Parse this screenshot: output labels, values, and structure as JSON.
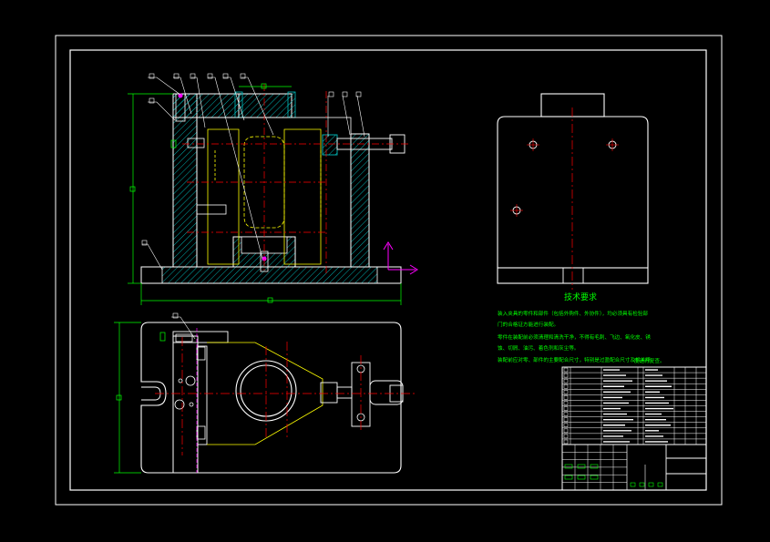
{
  "drawing": {
    "background": "#000000",
    "colors": {
      "outline": "#ffffff",
      "hatch": "#00c0c0",
      "centerline": "#ff0000",
      "hidden": "#ffff00",
      "dimension": "#00ff00",
      "ucs": "#ff00ff",
      "leader": "#ffffff",
      "title_block_text": "#00ff00"
    },
    "tech_requirements": {
      "title": "技术要求",
      "lines": [
        "装入夹具的零件和部件（包括外购件、外协件），均必须具有检验部",
        "门的合格证方能进行装配。",
        "零件在装配前必须清理和清洗干净，不得有毛刺、飞边、氧化皮、锈",
        "蚀、切屑、油污、着色剂和灰尘等。",
        "装配前应对零、部件的主要配合尺寸，特别是过盈配合尺寸及相关精",
        "度进行复查。"
      ]
    },
    "balloons": {
      "front_view": [
        "",
        "",
        "",
        "",
        "",
        "",
        "",
        "",
        ""
      ],
      "plan_view": [
        ""
      ],
      "base": [
        ""
      ]
    },
    "ucs_icon": {
      "x_label": "",
      "y_label": ""
    }
  }
}
